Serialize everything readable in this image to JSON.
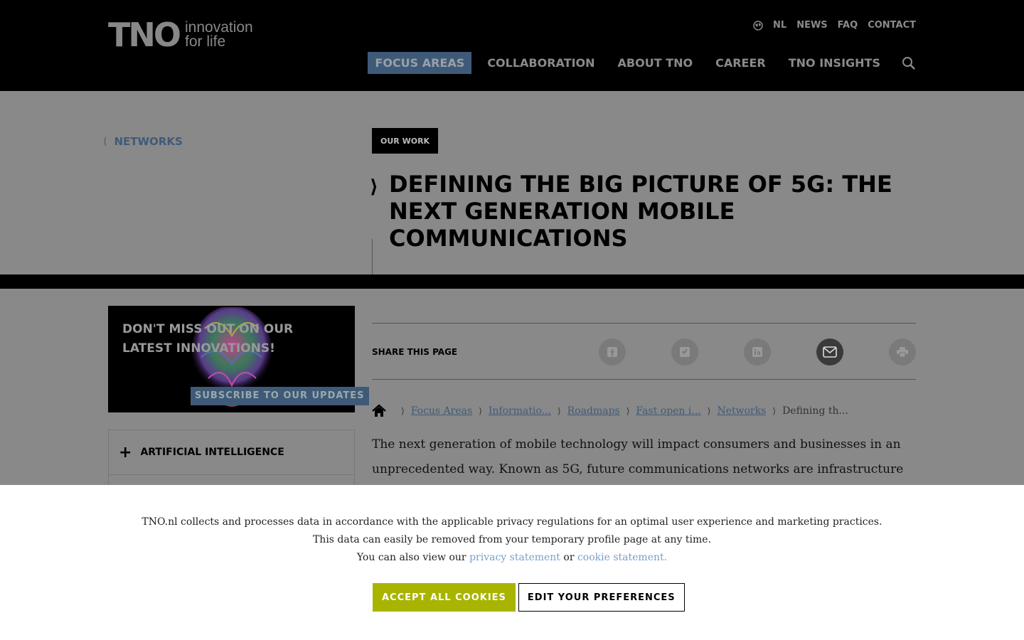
{
  "header": {
    "logo_mark": "TNO",
    "logo_tagline_1": "innovation",
    "logo_tagline_2": "for life",
    "top_links": [
      "NL",
      "NEWS",
      "FAQ",
      "CONTACT"
    ],
    "main_nav": [
      "FOCUS AREAS",
      "COLLABORATION",
      "ABOUT TNO",
      "CAREER",
      "TNO INSIGHTS"
    ]
  },
  "hero": {
    "back_label": "NETWORKS",
    "tag": "OUR WORK",
    "title": "DEFINING THE BIG PICTURE OF 5G: THE NEXT GENERATION MOBILE COMMUNICATIONS"
  },
  "promo": {
    "title": "DON'T MISS OUT ON OUR LATEST INNOVATIONS!",
    "button": "SUBSCRIBE TO OUR UPDATES"
  },
  "accordion": {
    "items": [
      "ARTIFICIAL INTELLIGENCE"
    ]
  },
  "share": {
    "label": "SHARE THIS PAGE"
  },
  "breadcrumb": {
    "items": [
      "Focus Areas",
      "Informatio...",
      "Roadmaps",
      "Fast open i...",
      "Networks"
    ],
    "current": "Defining th..."
  },
  "intro": "The next generation of mobile technology will impact consumers and businesses in an unprecedented way. Known as 5G, future communications networks are infrastructure and",
  "cookie": {
    "line1": "TNO.nl collects and processes data in accordance with the applicable privacy regulations for an optimal user experience and marketing practices.",
    "line2": "This data can easily be removed from your temporary profile page at any time.",
    "line3_prefix": "You can also view our",
    "privacy_link": "privacy statement",
    "or": "or",
    "cookie_link": "cookie statement.",
    "accept": "ACCEPT ALL COOKIES",
    "edit": "EDIT YOUR PREFERENCES"
  }
}
